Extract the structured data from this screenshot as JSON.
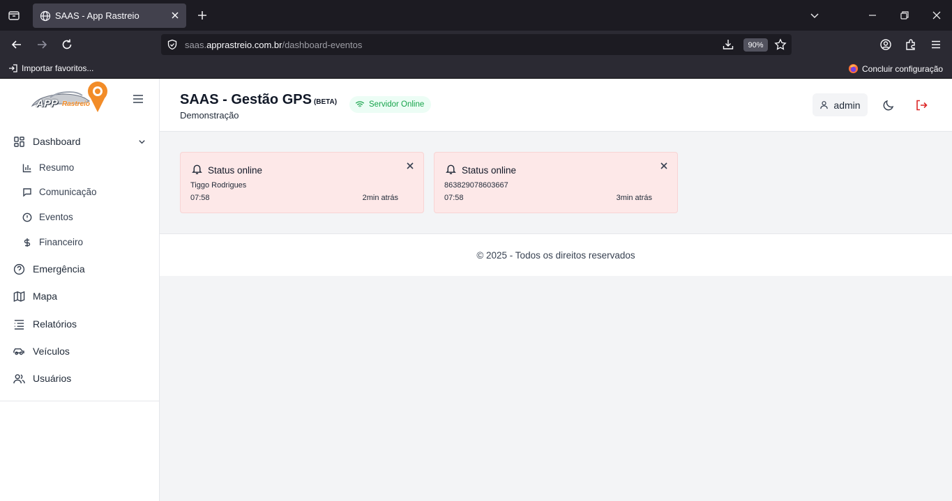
{
  "browser": {
    "tab_title": "SAAS - App Rastreio",
    "url_prefix": "saas.",
    "url_domain": "apprastreio.com.br",
    "url_path": "/dashboard-eventos",
    "zoom": "90%",
    "bookmark_import": "Importar favoritos...",
    "bookmark_setup": "Concluir configuração"
  },
  "brand": {
    "logo_text_1": "APP",
    "logo_text_2": "Rastreio"
  },
  "sidebar": {
    "items": [
      {
        "label": "Dashboard",
        "icon": "grid-icon"
      },
      {
        "label": "Resumo",
        "icon": "bar-chart-icon"
      },
      {
        "label": "Comunicação",
        "icon": "message-icon"
      },
      {
        "label": "Eventos",
        "icon": "alert-circle-icon"
      },
      {
        "label": "Financeiro",
        "icon": "dollar-icon"
      },
      {
        "label": "Emergência",
        "icon": "help-circle-icon"
      },
      {
        "label": "Mapa",
        "icon": "map-icon"
      },
      {
        "label": "Relatórios",
        "icon": "list-icon"
      },
      {
        "label": "Veículos",
        "icon": "car-icon"
      },
      {
        "label": "Usuários",
        "icon": "users-icon"
      }
    ]
  },
  "header": {
    "title": "SAAS - Gestão GPS",
    "beta": "(BETA)",
    "subtitle": "Demonstração",
    "status": "Servidor Online",
    "user": "admin"
  },
  "cards": [
    {
      "title": "Status online",
      "name": "Tiggo Rodrigues",
      "time": "07:58",
      "ago": "2min atrás"
    },
    {
      "title": "Status online",
      "name": "863829078603667",
      "time": "07:58",
      "ago": "3min atrás"
    }
  ],
  "footer": {
    "text": "© 2025 - Todos os direitos reservados"
  },
  "colors": {
    "accent_online": "#16a34a",
    "card_bg": "#fde8e8",
    "logout": "#dc2626",
    "logo_orange": "#f28c28"
  }
}
